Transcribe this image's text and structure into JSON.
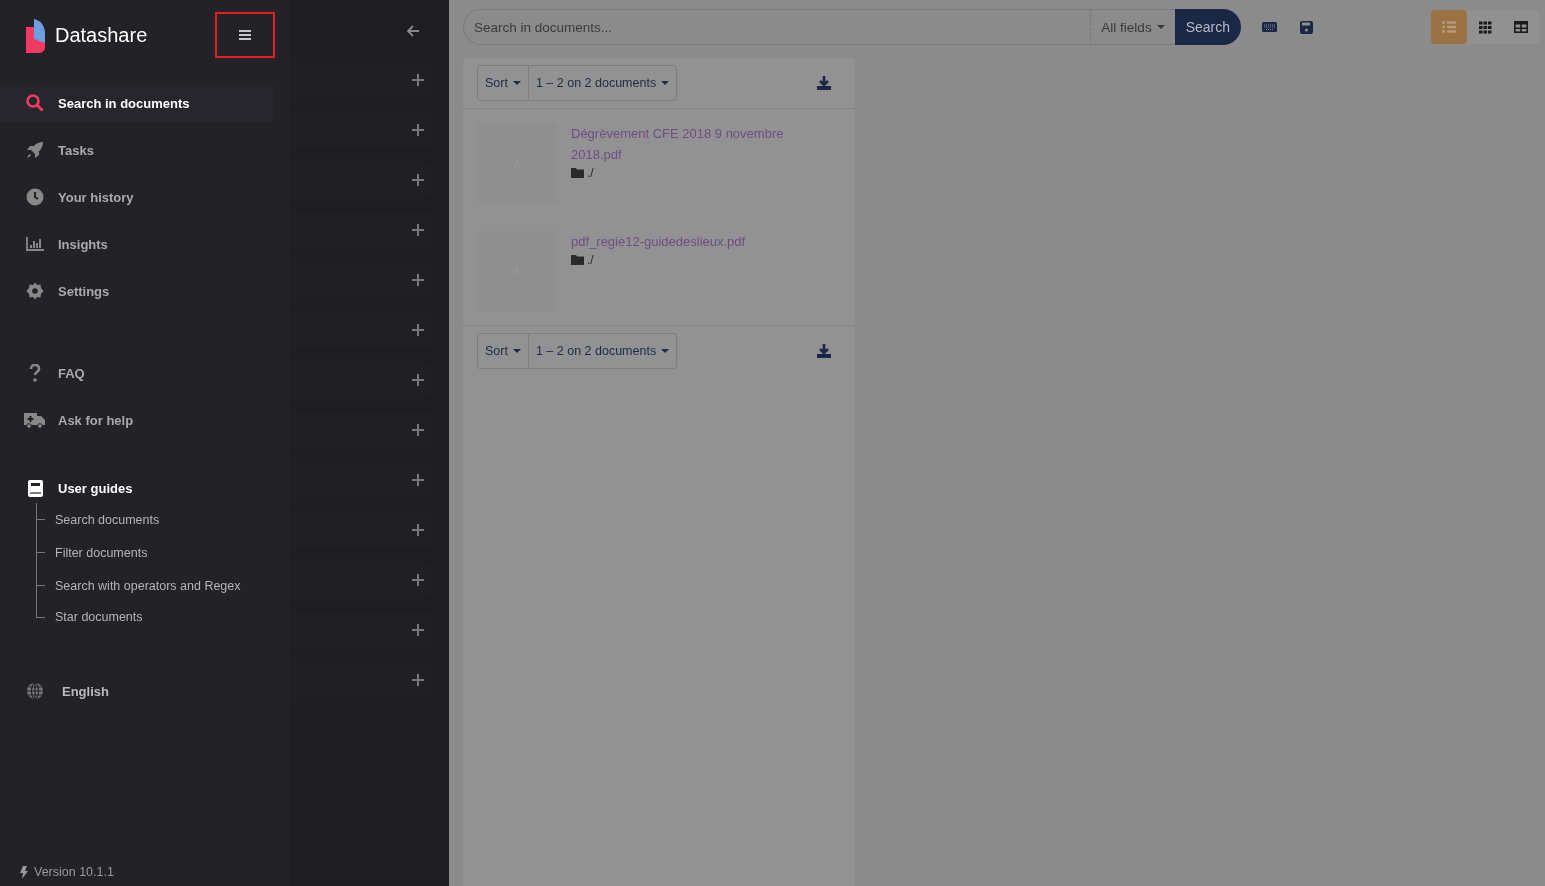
{
  "brand": {
    "name": "Datashare"
  },
  "menu_button": {
    "highlighted": true
  },
  "nav": [
    {
      "kind": "search",
      "label": "Search in documents",
      "selected": true
    },
    {
      "kind": "rocket",
      "label": "Tasks",
      "selected": false
    },
    {
      "kind": "clock",
      "label": "Your history",
      "selected": false
    },
    {
      "kind": "chart",
      "label": "Insights",
      "selected": false
    },
    {
      "kind": "gear",
      "label": "Settings",
      "selected": false
    }
  ],
  "help": [
    {
      "kind": "question",
      "label": "FAQ"
    },
    {
      "kind": "ambulance",
      "label": "Ask for help"
    }
  ],
  "guides": {
    "label": "User guides",
    "children": [
      {
        "label": "Search documents"
      },
      {
        "label": "Filter documents"
      },
      {
        "label": "Search with operators and Regex"
      },
      {
        "label": "Star documents"
      }
    ]
  },
  "language": "English",
  "version": "Version 10.1.1",
  "filters": [
    {
      "expanded": false
    },
    {
      "expanded": false
    },
    {
      "expanded": false
    },
    {
      "expanded": false
    },
    {
      "expanded": false
    },
    {
      "expanded": false
    },
    {
      "expanded": false
    },
    {
      "expanded": false
    },
    {
      "expanded": false
    },
    {
      "expanded": false
    },
    {
      "expanded": false
    },
    {
      "expanded": false
    },
    {
      "expanded": false
    }
  ],
  "search": {
    "placeholder": "Search in documents...",
    "field": "All fields",
    "button": "Search"
  },
  "views": [
    {
      "kind": "list",
      "selected": true
    },
    {
      "kind": "grid",
      "selected": false
    },
    {
      "kind": "table",
      "selected": false
    }
  ],
  "results": {
    "sort": "Sort",
    "count": "1 – 2 on 2 documents",
    "documents": [
      {
        "title": "Dégrèvement CFE 2018 9 novembre 2018.pdf",
        "path": "./"
      },
      {
        "title": "pdf_regie12-guidedeslieux.pdf",
        "path": "./"
      }
    ],
    "footer_sort": "Sort",
    "footer_count": "1 – 2 on 2 documents"
  }
}
